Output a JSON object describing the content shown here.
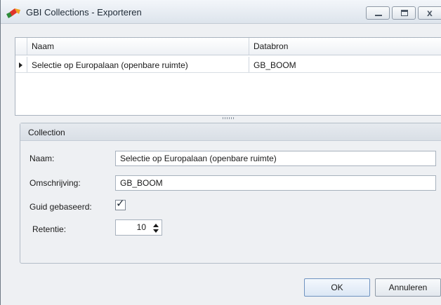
{
  "window": {
    "title": "GBI Collections - Exporteren",
    "close_glyph": "x"
  },
  "grid": {
    "columns": [
      "Naam",
      "Databron"
    ],
    "rows": [
      {
        "naam": "Selectie op Europalaan (openbare ruimte)",
        "databron": "GB_BOOM"
      }
    ]
  },
  "collection": {
    "title": "Collection",
    "naam_label": "Naam:",
    "naam_value": "Selectie op Europalaan (openbare ruimte)",
    "omschrijving_label": "Omschrijving:",
    "omschrijving_value": "GB_BOOM",
    "guid_label": "Guid gebaseerd:",
    "guid_checked": true,
    "retentie_label": "Retentie:",
    "retentie_value": "10"
  },
  "buttons": {
    "ok_label": "OK",
    "cancel_label": "Annuleren"
  },
  "icons": {
    "app": "app-logo-icon",
    "minimize": "minimize-icon",
    "maximize": "maximize-icon",
    "close": "close-icon",
    "row_indicator": "row-indicator-icon",
    "check": "checkmark-icon",
    "spin_up": "spin-up-icon",
    "spin_down": "spin-down-icon"
  },
  "colors": {
    "window_bg": "#eef0f3",
    "titlebar_top": "#f3f6fa",
    "ok_border": "#6f93c0"
  }
}
